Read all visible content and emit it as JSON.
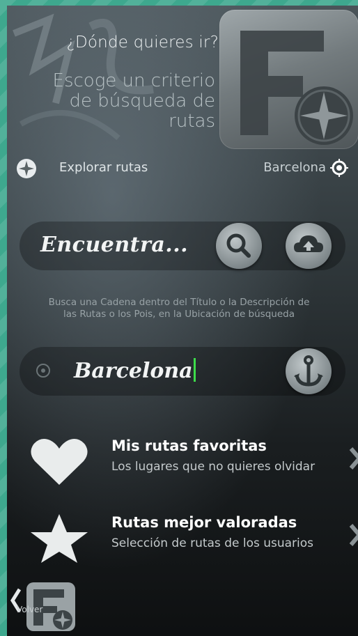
{
  "header": {
    "question": "¿Dónde quieres ir?",
    "subtitle_lines": [
      "Escoge un criterio",
      "de búsqueda de",
      "rutas"
    ]
  },
  "explore": {
    "label": "Explorar rutas",
    "city": "Barcelona"
  },
  "search": {
    "text": "Encuentra...",
    "hint_lines": [
      "Busca una Cadena dentro del Título o la Descripción de",
      "las Rutas o los Pois, en la Ubicación de búsqueda"
    ]
  },
  "location": {
    "value": "Barcelona"
  },
  "menu": [
    {
      "title": "Mis rutas favoritas",
      "description": "Los lugares que no quieres olvidar",
      "icon": "heart-icon"
    },
    {
      "title": "Rutas mejor valoradas",
      "description": "Selección de rutas de los usuarios",
      "icon": "star-icon"
    }
  ],
  "footer": {
    "back_label": "Volver"
  },
  "colors": {
    "background_outer": "#3ea88e",
    "caret": "#3ddc4a",
    "text_primary": "#ffffff"
  }
}
